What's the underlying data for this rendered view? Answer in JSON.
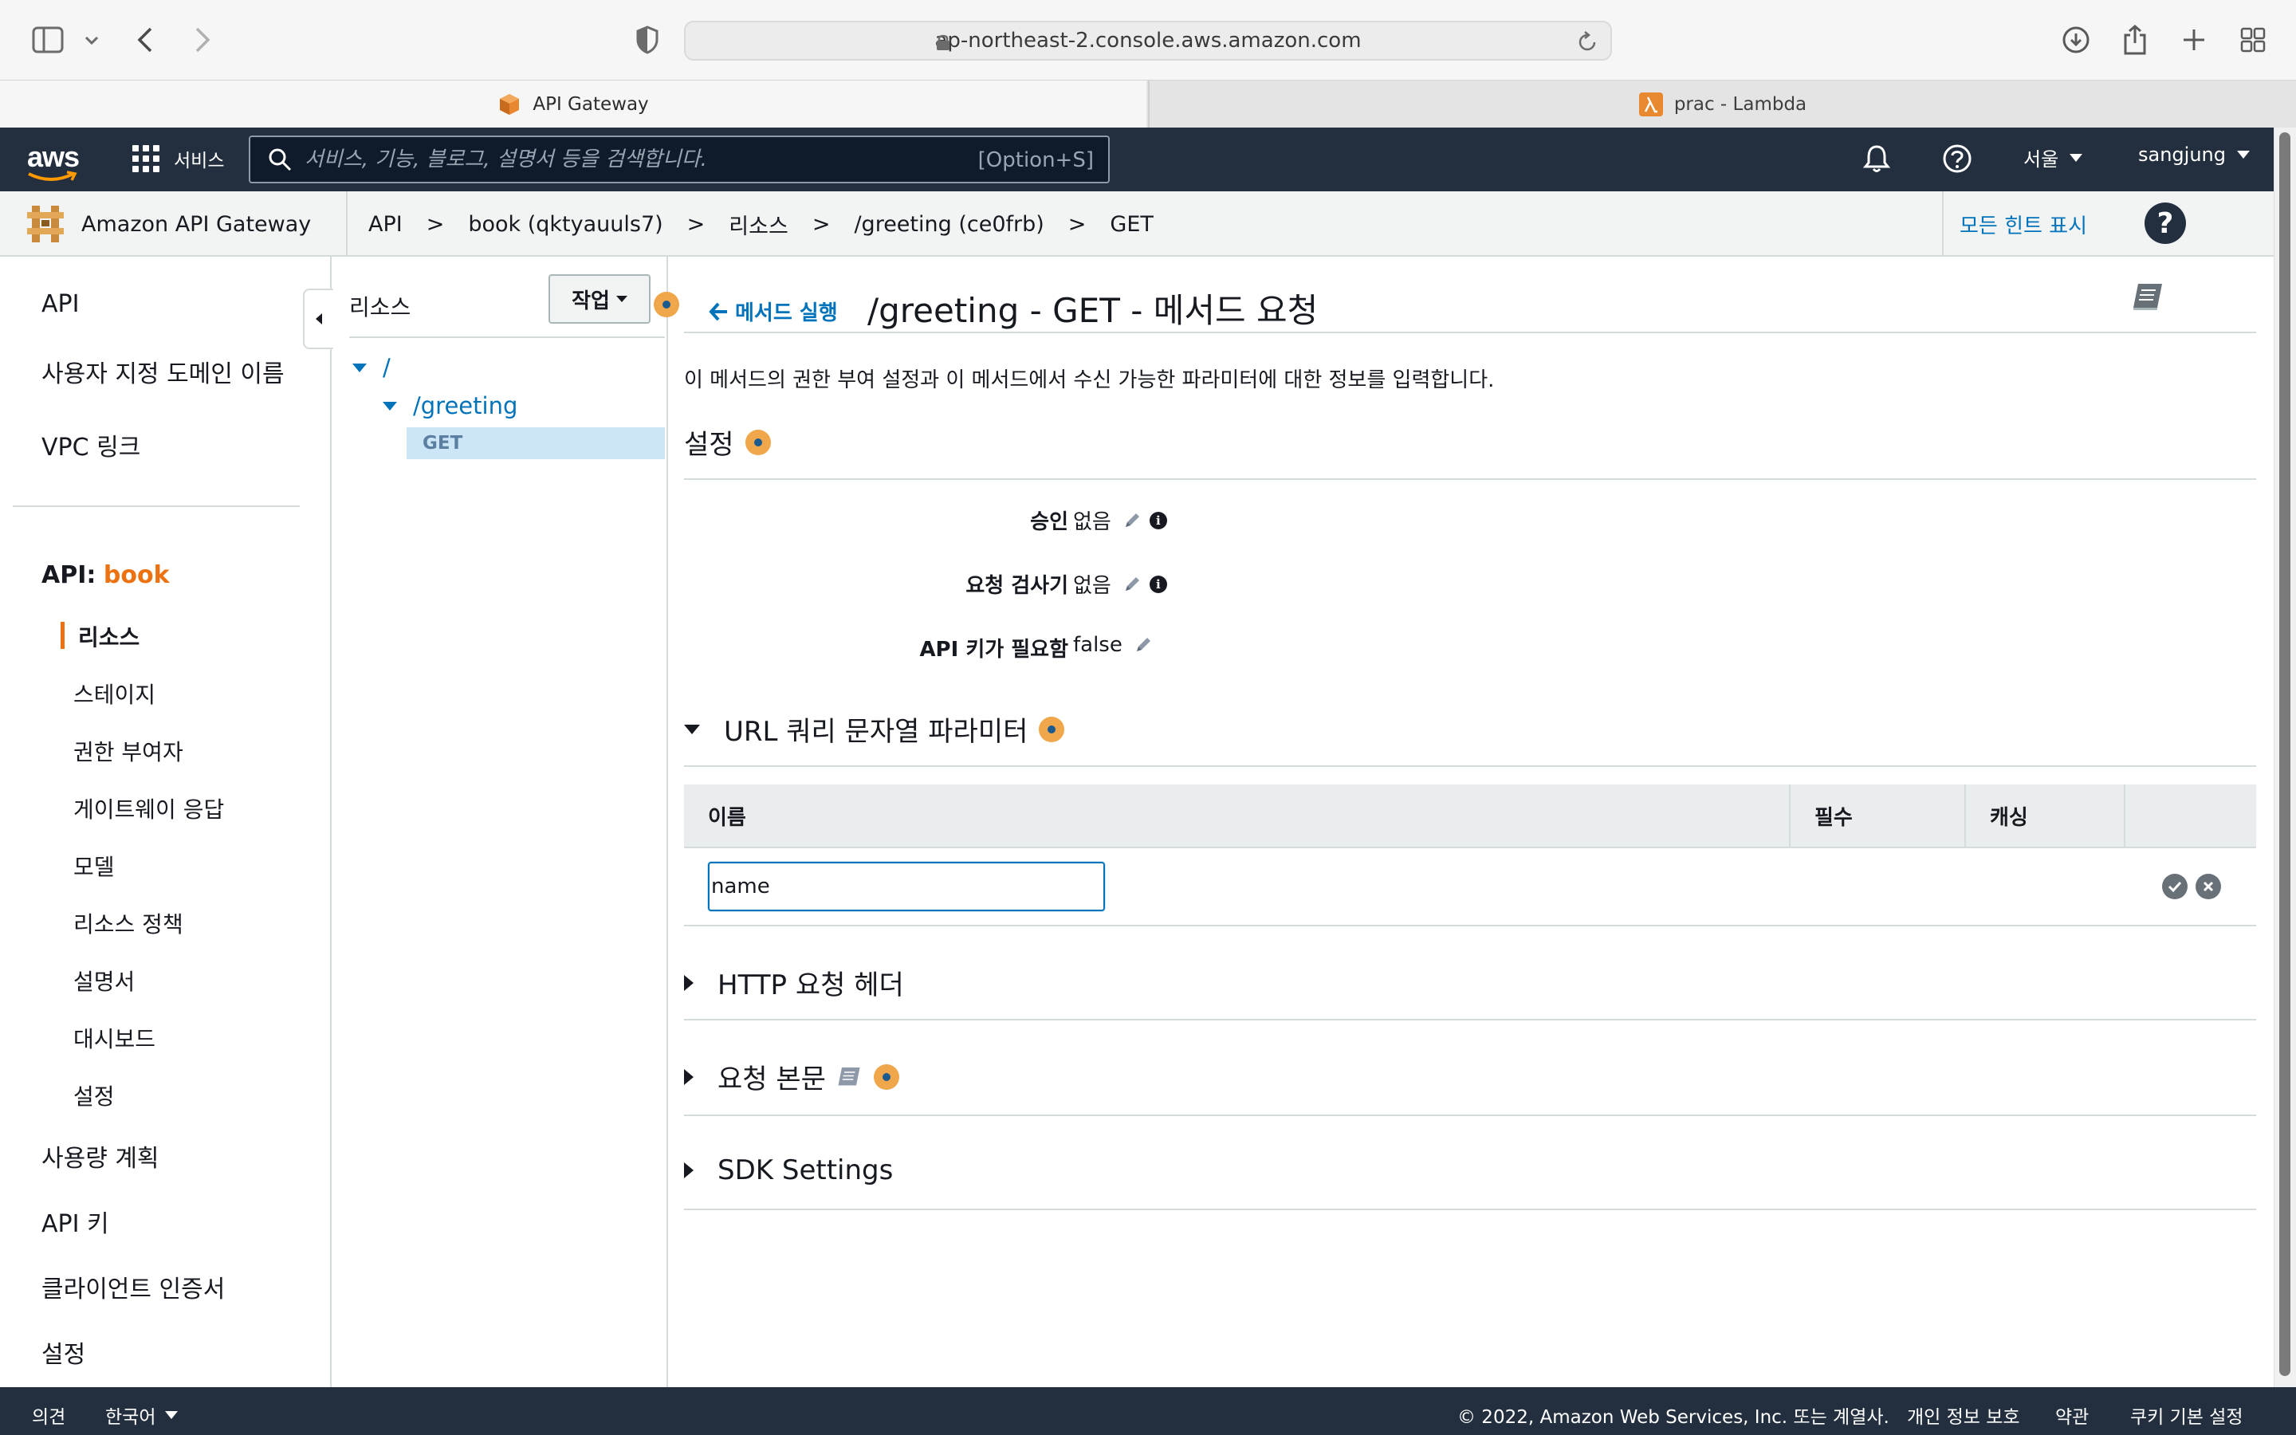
{
  "browser": {
    "url": "ap-northeast-2.console.aws.amazon.com",
    "tabs": [
      {
        "label": "API Gateway",
        "active": true
      },
      {
        "label": "prac - Lambda",
        "active": false
      }
    ]
  },
  "topnav": {
    "logo": "aws",
    "services": "서비스",
    "search_placeholder": "서비스, 기능, 블로그, 설명서 등을 검색합니다.",
    "search_shortcut": "[Option+S]",
    "region": "서울",
    "user": "sangjung"
  },
  "service_bar": {
    "name": "Amazon API Gateway",
    "breadcrumbs": [
      "API",
      "book (qktyauuls7)",
      "리소스",
      "/greeting (ce0frb)",
      "GET"
    ],
    "separator": ">",
    "hints": "모든 힌트 표시",
    "help": "?"
  },
  "left_nav": {
    "top_items": [
      "API",
      "사용자 지정 도메인 이름",
      "VPC 링크"
    ],
    "api_prefix": "API:",
    "api_name": "book",
    "sub_items": [
      "리소스",
      "스테이지",
      "권한 부여자",
      "게이트웨이 응답",
      "모델",
      "리소스 정책",
      "설명서",
      "대시보드",
      "설정"
    ],
    "bottom_items": [
      "사용량 계획",
      "API 키",
      "클라이언트 인증서",
      "설정"
    ]
  },
  "tree": {
    "title": "리소스",
    "actions": "작업",
    "root": "/",
    "child": "/greeting",
    "method": "GET"
  },
  "main": {
    "back_link": "메서드 실행",
    "title": "/greeting - GET - 메서드 요청",
    "description": "이 메서드의 권한 부여 설정과 이 메서드에서 수신 가능한 파라미터에 대한 정보를 입력합니다.",
    "settings_title": "설정",
    "settings": [
      {
        "label": "승인",
        "value": "없음"
      },
      {
        "label": "요청 검사기",
        "value": "없음"
      },
      {
        "label": "API 키가 필요함",
        "value": "false"
      }
    ],
    "query_title": "URL 쿼리 문자열 파라미터",
    "query_columns": [
      "이름",
      "필수",
      "캐싱"
    ],
    "query_input_value": "name",
    "http_headers_title": "HTTP 요청 헤더",
    "request_body_title": "요청 본문",
    "sdk_title": "SDK Settings"
  },
  "footer": {
    "feedback": "의견",
    "language": "한국어",
    "copyright": "© 2022, Amazon Web Services, Inc. 또는 계열사.",
    "privacy": "개인 정보 보호",
    "terms": "약관",
    "cookies": "쿠키 기본 설정"
  },
  "colors": {
    "aws_nav": "#232f3e",
    "link": "#0073bb",
    "accent": "#ec7211"
  }
}
